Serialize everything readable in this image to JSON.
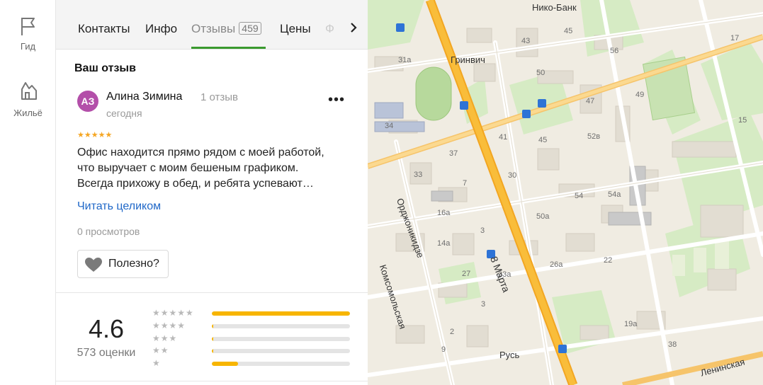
{
  "sidebar": {
    "items": [
      {
        "label": "Гид",
        "icon": "flag-icon"
      },
      {
        "label": "Жильё",
        "icon": "house-icon"
      }
    ]
  },
  "tabs": {
    "items": [
      {
        "label": "Контакты"
      },
      {
        "label": "Инфо"
      },
      {
        "label": "Отзывы",
        "count": "459",
        "active": true
      },
      {
        "label": "Цены"
      },
      {
        "label": "Ф"
      }
    ]
  },
  "review": {
    "section_title": "Ваш отзыв",
    "avatar_initials": "АЗ",
    "avatar_color": "#b34fa9",
    "author": "Алина Зимина",
    "author_reviews": "1 отзыв",
    "date": "сегодня",
    "rating": 5,
    "text_lines": [
      "Офис находится прямо рядом с моей работой,",
      "что выручает с моим бешеным графиком.",
      "Всегда прихожу в обед, и ребята успевают…"
    ],
    "read_more": "Читать целиком",
    "views": "0 просмотров",
    "useful_label": "Полезно?"
  },
  "summary": {
    "rating": "4.6",
    "count": "573 оценки",
    "distribution": [
      {
        "stars": 5,
        "fraction": 1.0
      },
      {
        "stars": 4,
        "fraction": 0.01
      },
      {
        "stars": 3,
        "fraction": 0.01
      },
      {
        "stars": 2,
        "fraction": 0.01
      },
      {
        "stars": 1,
        "fraction": 0.19
      }
    ]
  },
  "map": {
    "pois": [
      {
        "label": "Нико-Банк"
      },
      {
        "label": "Гринвич"
      },
      {
        "label": "Русь"
      }
    ],
    "streets": [
      "8 Марта",
      "Орджоникидзе",
      "Комсомольская",
      "Ленинская"
    ],
    "house_numbers": [
      "45",
      "43",
      "56",
      "17",
      "31а",
      "50",
      "49",
      "47",
      "34",
      "52в",
      "15",
      "41",
      "45",
      "37",
      "33",
      "30",
      "54а",
      "7",
      "54",
      "16а",
      "50а",
      "3",
      "14а",
      "26а",
      "22",
      "27",
      "33а",
      "2",
      "19а",
      "9",
      "38",
      "3"
    ]
  },
  "colors": {
    "accent_green": "#3a9a2f",
    "link_blue": "#2068c8",
    "star_yellow": "#f7b500",
    "main_road": "#f6b73c"
  }
}
